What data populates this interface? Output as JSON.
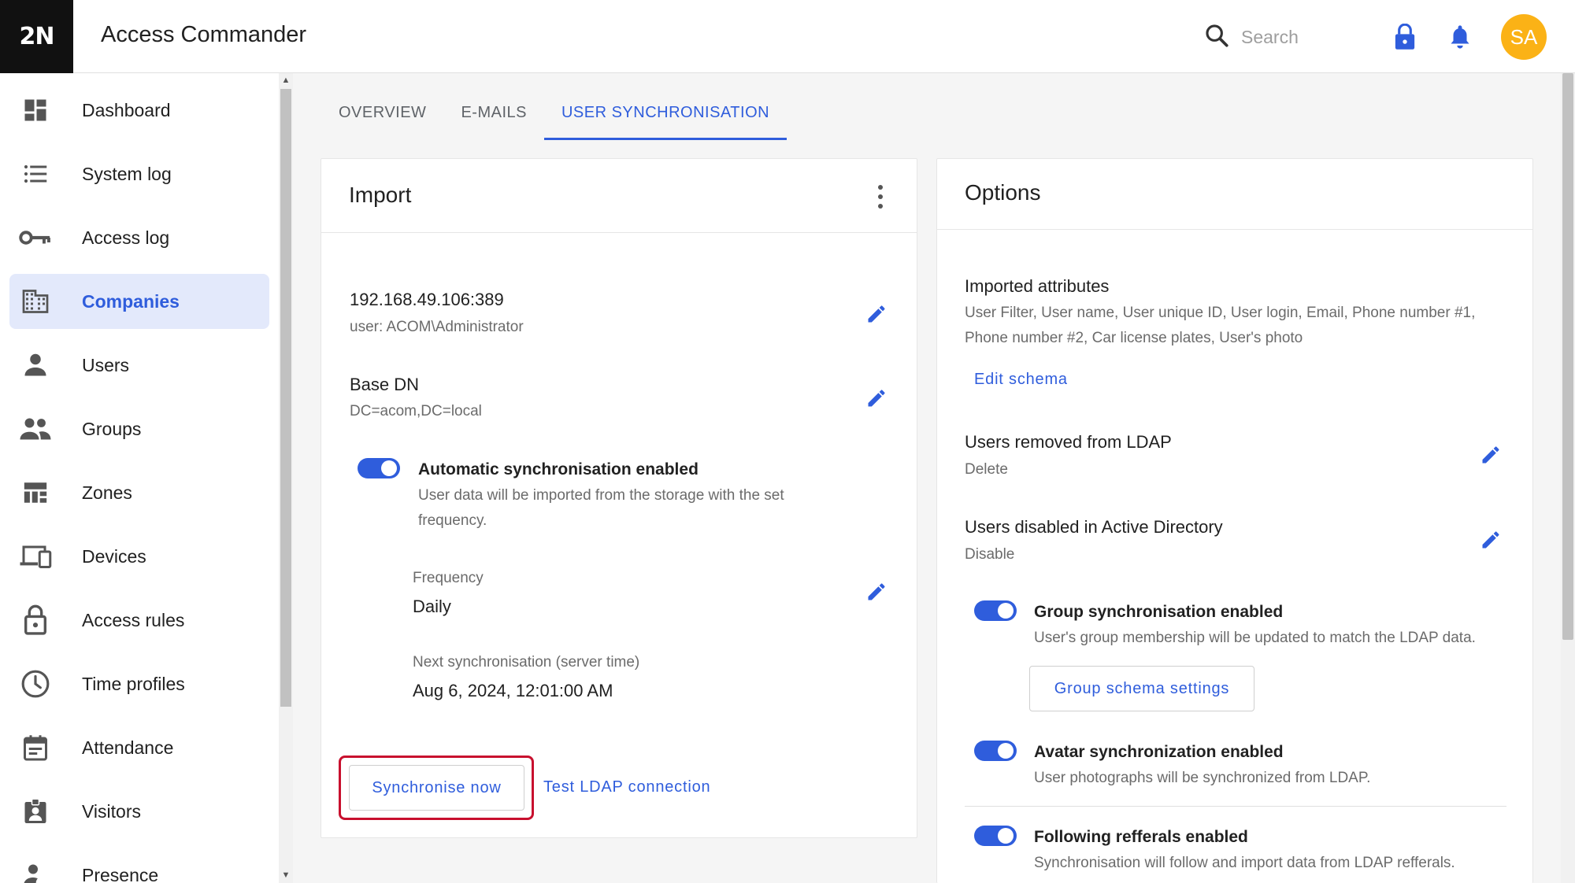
{
  "header": {
    "logo": "2N",
    "app_title": "Access Commander",
    "search_placeholder": "Search",
    "avatar_initials": "SA"
  },
  "sidebar": {
    "items": [
      {
        "label": "Dashboard",
        "icon": "dashboard-icon"
      },
      {
        "label": "System log",
        "icon": "list-icon"
      },
      {
        "label": "Access log",
        "icon": "key-icon"
      },
      {
        "label": "Companies",
        "icon": "building-icon",
        "active": true
      },
      {
        "label": "Users",
        "icon": "person-icon"
      },
      {
        "label": "Groups",
        "icon": "people-icon"
      },
      {
        "label": "Zones",
        "icon": "zones-icon"
      },
      {
        "label": "Devices",
        "icon": "devices-icon"
      },
      {
        "label": "Access rules",
        "icon": "lock-icon"
      },
      {
        "label": "Time profiles",
        "icon": "clock-icon"
      },
      {
        "label": "Attendance",
        "icon": "calendar-icon"
      },
      {
        "label": "Visitors",
        "icon": "badge-icon"
      },
      {
        "label": "Presence",
        "icon": "presence-icon"
      }
    ]
  },
  "tabs": [
    {
      "label": "OVERVIEW"
    },
    {
      "label": "E-MAILS"
    },
    {
      "label": "USER SYNCHRONISATION",
      "active": true
    }
  ],
  "import_card": {
    "title": "Import",
    "server": {
      "value": "192.168.49.106:389",
      "sub": "user: ACOM\\Administrator"
    },
    "base_dn": {
      "title": "Base DN",
      "value": "DC=acom,DC=local"
    },
    "auto_sync": {
      "title": "Automatic synchronisation enabled",
      "desc_line1": "User data will be imported from the storage with the set",
      "desc_line2": "frequency.",
      "enabled": true
    },
    "frequency": {
      "label": "Frequency",
      "value": "Daily"
    },
    "next_sync": {
      "label": "Next synchronisation (server time)",
      "value": "Aug 6, 2024, 12:01:00 AM"
    },
    "sync_button": "Synchronise now",
    "test_button": "Test LDAP connection"
  },
  "options_card": {
    "title": "Options",
    "imported_attributes": {
      "title": "Imported attributes",
      "line1": "User Filter, User name, User unique ID, User login, Email, Phone number #1,",
      "line2": "Phone number #2, Car license plates, User's photo",
      "edit_link": "Edit schema"
    },
    "removed": {
      "title": "Users removed from LDAP",
      "value": "Delete"
    },
    "disabled": {
      "title": "Users disabled in Active Directory",
      "value": "Disable"
    },
    "group_sync": {
      "title": "Group synchronisation enabled",
      "desc": "User's group membership will be updated to match the LDAP data.",
      "button": "Group schema settings",
      "enabled": true
    },
    "avatar_sync": {
      "title": "Avatar synchronization enabled",
      "desc": "User photographs will be synchronized from LDAP.",
      "enabled": true
    },
    "referrals": {
      "title": "Following refferals enabled",
      "desc": "Synchronisation will follow and import data from LDAP refferals.",
      "enabled": true
    }
  },
  "colors": {
    "accent": "#2f5ddc",
    "avatar": "#fbb216",
    "highlight": "#c8102e"
  }
}
